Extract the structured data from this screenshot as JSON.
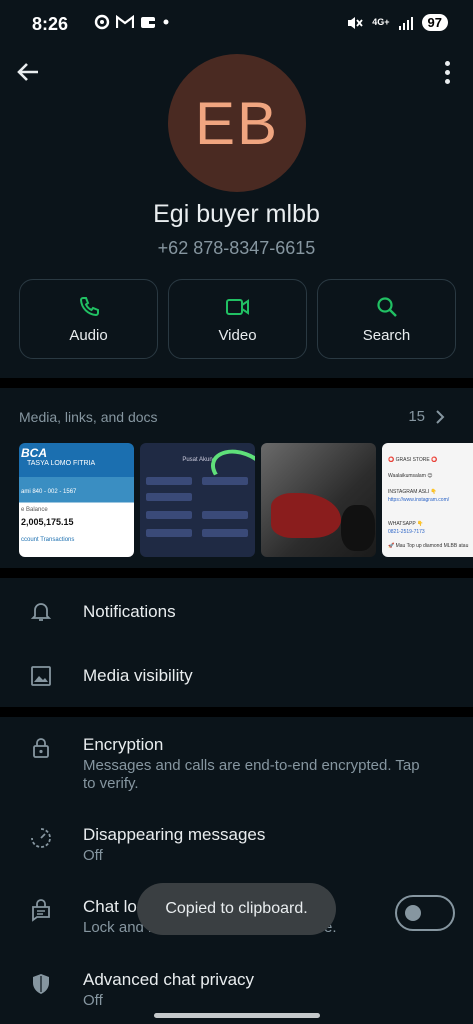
{
  "status": {
    "time": "8:26",
    "network": "4G+",
    "battery": "97"
  },
  "contact": {
    "initials": "EB",
    "name": "Egi buyer mlbb",
    "phone": "+62 878-8347-6615"
  },
  "actions": [
    {
      "label": "Audio",
      "icon": "phone-icon"
    },
    {
      "label": "Video",
      "icon": "video-icon"
    },
    {
      "label": "Search",
      "icon": "search-icon"
    }
  ],
  "media": {
    "title": "Media, links, and docs",
    "count": "15",
    "thumb1": {
      "bank": "BCA",
      "name": "TASYA LOMO FITRIA",
      "account": "ami 840 - 002 - 1567",
      "balance_label": "e Balance",
      "balance": "2,005,175.15",
      "transactions": "ccount Transactions"
    },
    "thumb2": {
      "header": "Pusat Akun"
    },
    "thumb4": {
      "store": "⭕ GRASI STORE ⭕",
      "greeting": "Waalaikumsalam 😊",
      "ig_label": "INSTAGRAM ASLI 👇",
      "ig_link": "https://www.instagram.com/",
      "wa_label": "WHATSAPP 👇",
      "wa_number": "0821-2519-7173",
      "promo": "🚀 Mau Top up diamond MLBB atau"
    }
  },
  "settings": {
    "notifications": "Notifications",
    "media_visibility": "Media visibility",
    "encryption_title": "Encryption",
    "encryption_sub": "Messages and calls are end-to-end encrypted. Tap to verify.",
    "disappearing_title": "Disappearing messages",
    "disappearing_sub": "Off",
    "chat_lock_title": "Chat lock",
    "chat_lock_sub": "Lock and hide this chat on this device.",
    "chat_lock_on": false,
    "privacy_title": "Advanced chat privacy",
    "privacy_sub": "Off"
  },
  "toast": "Copied to clipboard.",
  "colors": {
    "background": "#0b141a",
    "accent": "#21c063",
    "avatar_bg": "#4a2a22",
    "avatar_text": "#f0a580"
  }
}
